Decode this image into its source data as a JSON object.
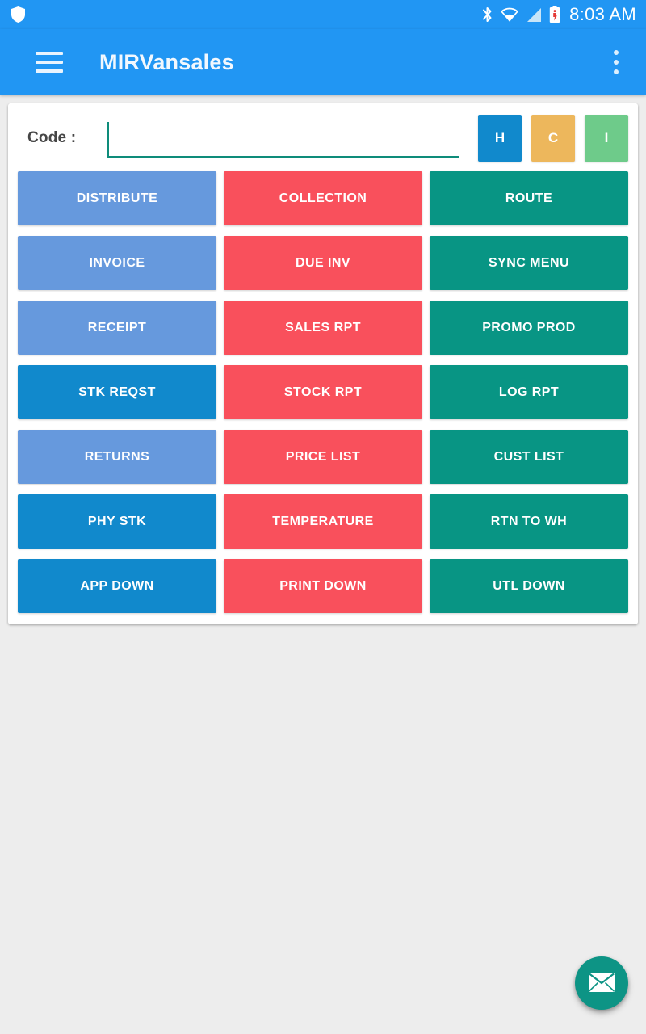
{
  "status_bar": {
    "shield_icon": "shield-icon",
    "bluetooth_icon": "bluetooth-icon",
    "wifi_icon": "wifi-icon",
    "signal_icon": "signal-icon",
    "battery_icon": "battery-icon",
    "time": "8:03 AM",
    "background_color": "#2196F3"
  },
  "app_bar": {
    "menu_icon": "hamburger-menu-icon",
    "title": "MIRVansales",
    "overflow_icon": "more-vertical-icon",
    "background_color": "#2196F3"
  },
  "code_row": {
    "label": "Code :",
    "value": "",
    "placeholder": "",
    "underline_color": "#0E8C7A",
    "buttons": [
      {
        "label": "H",
        "color": "#1189CC",
        "name": "code-button-h"
      },
      {
        "label": "C",
        "color": "#EDB75C",
        "name": "code-button-c"
      },
      {
        "label": "I",
        "color": "#6ECB8A",
        "name": "code-button-i"
      }
    ]
  },
  "palette": {
    "light_blue": "#6699DD",
    "dark_blue": "#1189CC",
    "coral_red": "#F9505C",
    "teal": "#089584",
    "card_bg": "#FFFFFF",
    "page_bg": "#EDEDED"
  },
  "grid": {
    "rows": [
      [
        {
          "label": "DISTRIBUTE",
          "color": "#6699DD"
        },
        {
          "label": "COLLECTION",
          "color": "#F9505C"
        },
        {
          "label": "ROUTE",
          "color": "#089584"
        }
      ],
      [
        {
          "label": "INVOICE",
          "color": "#6699DD"
        },
        {
          "label": "DUE INV",
          "color": "#F9505C"
        },
        {
          "label": "SYNC MENU",
          "color": "#089584"
        }
      ],
      [
        {
          "label": "RECEIPT",
          "color": "#6699DD"
        },
        {
          "label": "SALES RPT",
          "color": "#F9505C"
        },
        {
          "label": "PROMO PROD",
          "color": "#089584"
        }
      ],
      [
        {
          "label": "STK REQST",
          "color": "#1189CC"
        },
        {
          "label": "STOCK RPT",
          "color": "#F9505C"
        },
        {
          "label": "LOG RPT",
          "color": "#089584"
        }
      ],
      [
        {
          "label": "RETURNS",
          "color": "#6699DD"
        },
        {
          "label": "PRICE LIST",
          "color": "#F9505C"
        },
        {
          "label": "CUST LIST",
          "color": "#089584"
        }
      ],
      [
        {
          "label": "PHY STK",
          "color": "#1189CC"
        },
        {
          "label": "TEMPERATURE",
          "color": "#F9505C"
        },
        {
          "label": "RTN TO WH",
          "color": "#089584"
        }
      ],
      [
        {
          "label": "APP DOWN",
          "color": "#1189CC"
        },
        {
          "label": "PRINT DOWN",
          "color": "#F9505C"
        },
        {
          "label": "UTL DOWN",
          "color": "#089584"
        }
      ]
    ]
  },
  "fab": {
    "icon": "mail-icon",
    "color": "#0D9485"
  }
}
